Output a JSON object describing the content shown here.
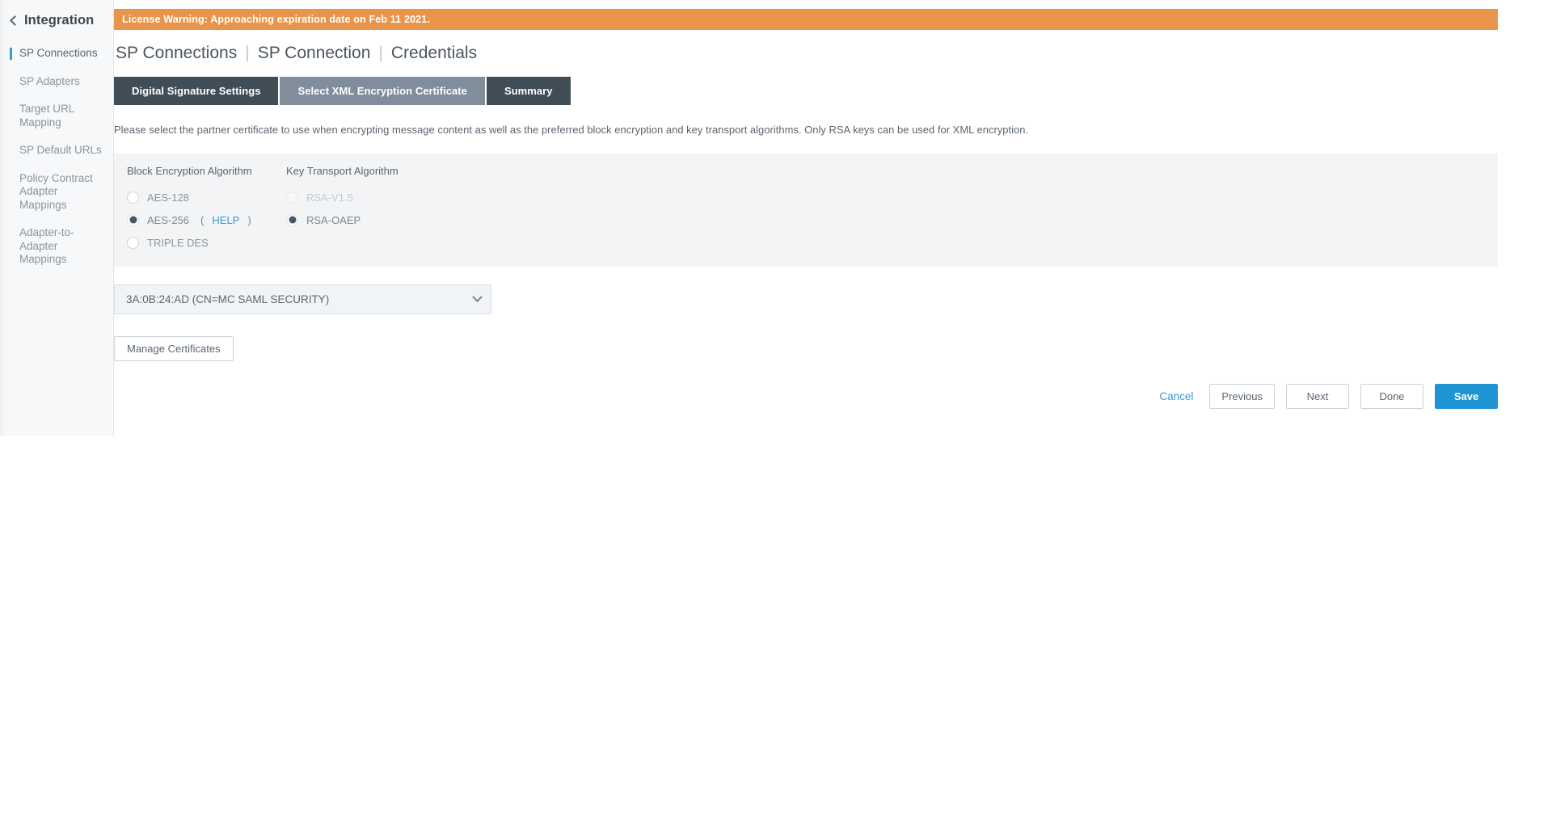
{
  "sidebar": {
    "back_icon": "chevron-left-icon",
    "title": "Integration",
    "items": [
      {
        "label": "SP Connections",
        "active": true
      },
      {
        "label": "SP Adapters",
        "active": false
      },
      {
        "label": "Target URL Mapping",
        "active": false
      },
      {
        "label": "SP Default URLs",
        "active": false
      },
      {
        "label": "Policy Contract Adapter Mappings",
        "active": false
      },
      {
        "label": "Adapter-to-Adapter Mappings",
        "active": false
      }
    ]
  },
  "banner": {
    "text": "License Warning: Approaching expiration date on Feb 11 2021.",
    "bg_color": "#e8944b",
    "text_color": "#ffffff"
  },
  "breadcrumb": {
    "crumb1": "SP Connections",
    "sep1": "|",
    "crumb2": "SP Connection",
    "sep2": "|",
    "crumb3": "Credentials"
  },
  "tabs": [
    {
      "label": "Digital Signature Settings",
      "state": "dark"
    },
    {
      "label": "Select XML Encryption Certificate",
      "state": "light"
    },
    {
      "label": "Summary",
      "state": "dark"
    }
  ],
  "main": {
    "description": "Please select the partner certificate to use when encrypting message content as well as the preferred block encryption and key transport algorithms. Only RSA keys can be used for XML encryption."
  },
  "block_encryption": {
    "heading": "Block Encryption Algorithm",
    "options": [
      {
        "label": "AES-128",
        "selected": false,
        "disabled": false,
        "help": null
      },
      {
        "label": "AES-256",
        "selected": true,
        "disabled": false,
        "help": "HELP"
      },
      {
        "label": "TRIPLE DES",
        "selected": false,
        "disabled": false,
        "help": null
      }
    ]
  },
  "key_transport": {
    "heading": "Key Transport Algorithm",
    "options": [
      {
        "label": "RSA-V1.5",
        "selected": false,
        "disabled": true,
        "help": null
      },
      {
        "label": "RSA-OAEP",
        "selected": true,
        "disabled": false,
        "help": null
      }
    ]
  },
  "certificate_select": {
    "value": "3A:0B:24:AD (CN=MC SAML SECURITY)",
    "chevron_icon": "chevron-down-icon"
  },
  "manage_certificates_button": {
    "label": "Manage Certificates"
  },
  "actions": {
    "cancel": "Cancel",
    "previous": "Previous",
    "next": "Next",
    "done": "Done",
    "save": "Save",
    "save_color": "#1f94d3"
  },
  "help_parens": {
    "open": "(",
    "close": ")"
  }
}
